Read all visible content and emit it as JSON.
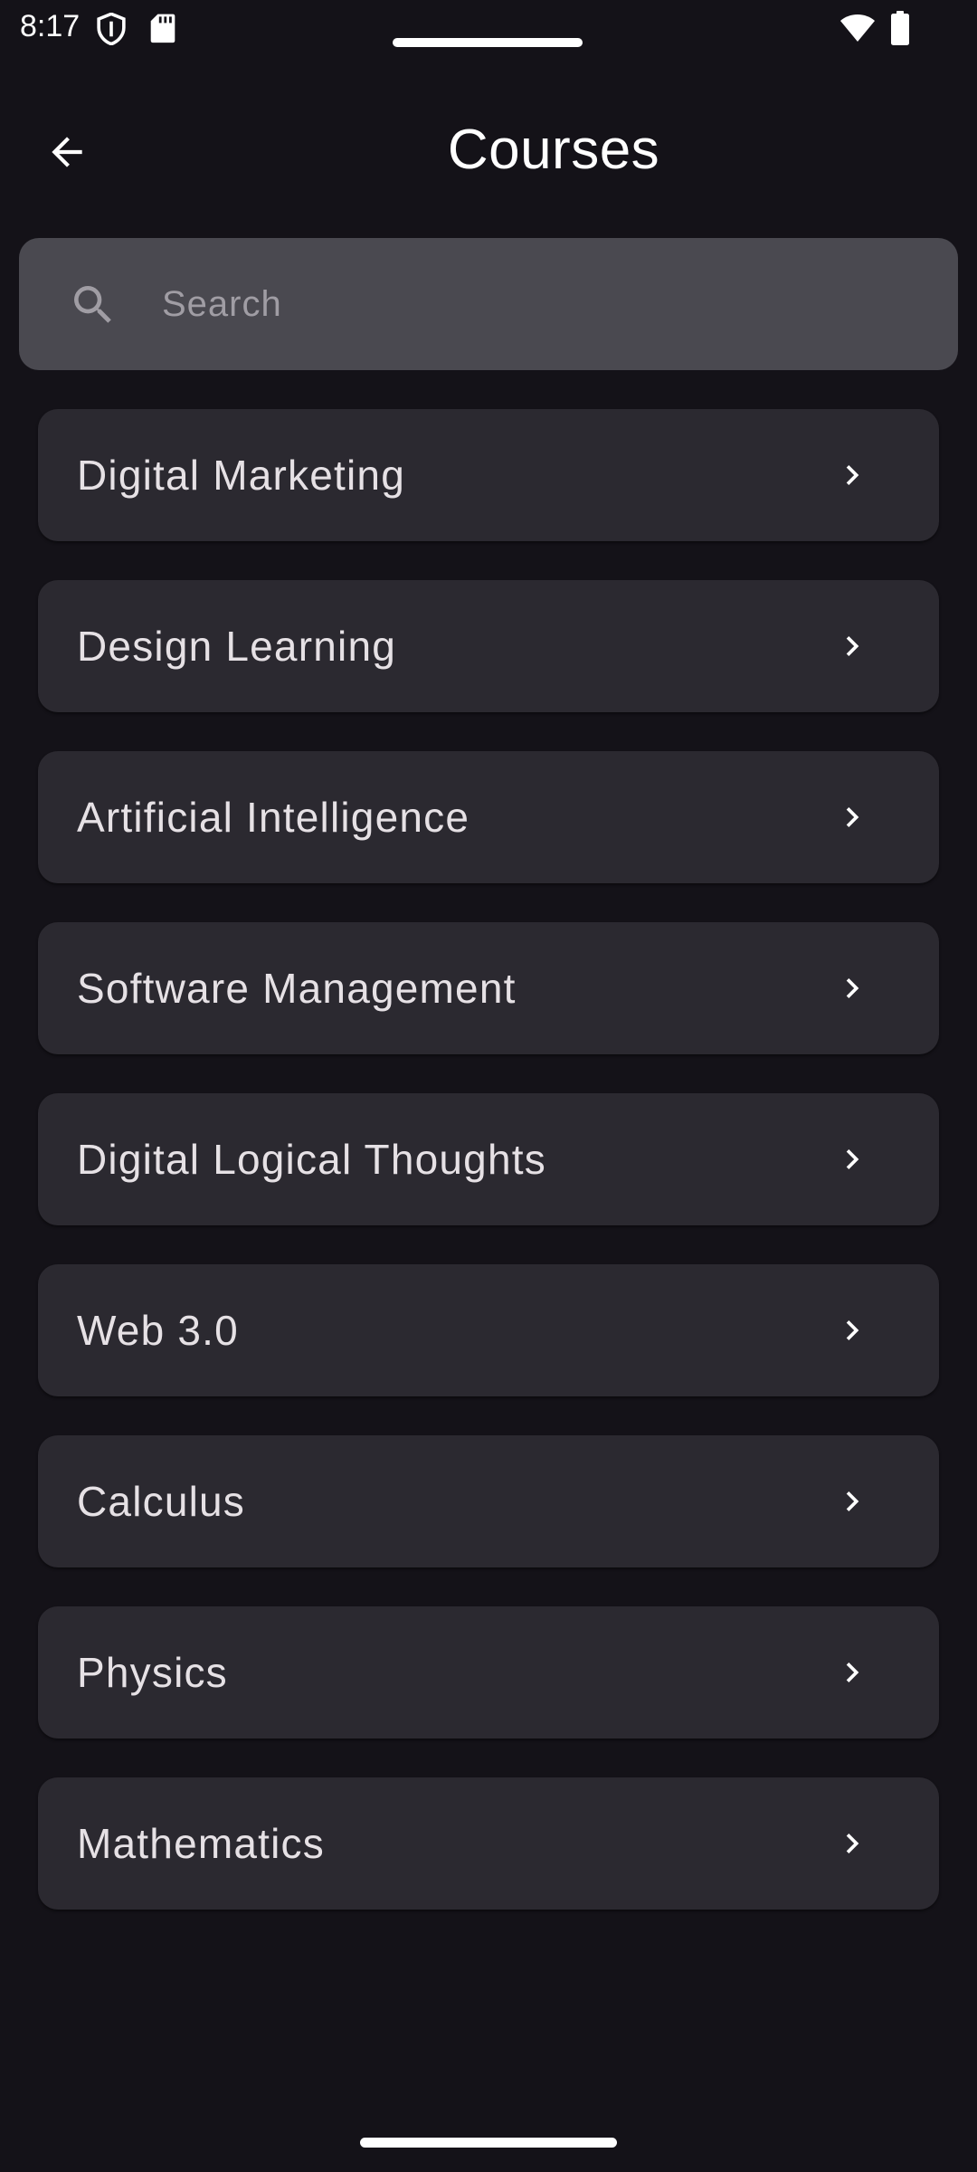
{
  "status_bar": {
    "time": "8:17"
  },
  "app_bar": {
    "title": "Courses"
  },
  "search": {
    "placeholder": "Search",
    "value": ""
  },
  "courses": [
    {
      "label": "Digital Marketing"
    },
    {
      "label": "Design Learning"
    },
    {
      "label": "Artificial Intelligence"
    },
    {
      "label": "Software Management"
    },
    {
      "label": "Digital Logical Thoughts"
    },
    {
      "label": "Web 3.0"
    },
    {
      "label": "Calculus"
    },
    {
      "label": "Physics"
    },
    {
      "label": "Mathematics"
    }
  ],
  "icons": {
    "status": [
      "shield-icon",
      "sd-card-icon",
      "wifi-icon",
      "battery-icon"
    ],
    "back": "arrow-back-icon",
    "search": "search-icon",
    "item_trailing": "chevron-right-icon"
  },
  "colors": {
    "background": "#141218",
    "search_field": "#4A4950",
    "card": "#2B2930",
    "text": "#E6E1E5",
    "placeholder": "#A09DA4"
  }
}
